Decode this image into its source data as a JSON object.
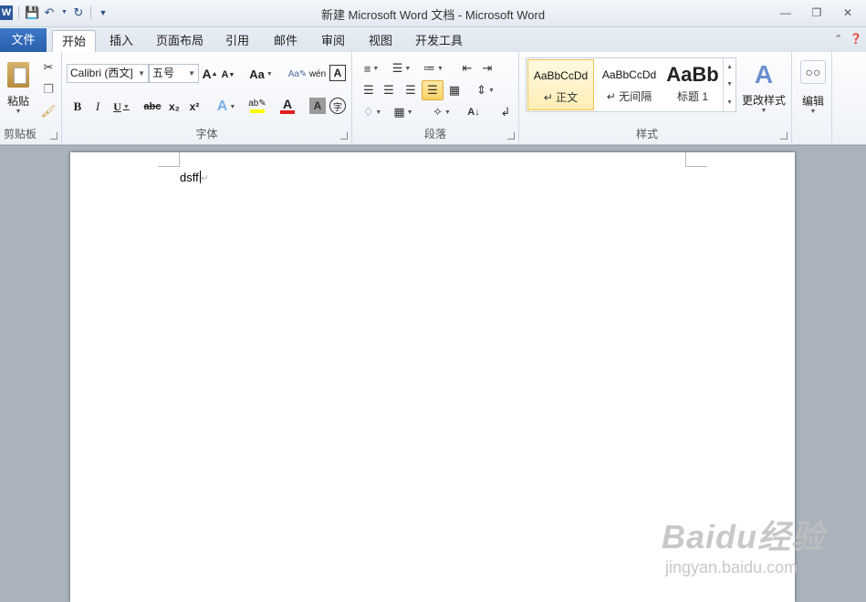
{
  "titlebar": {
    "title": "新建 Microsoft Word 文档 - Microsoft Word",
    "app_logo_letter": "W",
    "qat_icons": [
      "save-icon",
      "undo-icon",
      "redo-icon",
      "customize-qat-icon"
    ],
    "window_buttons": [
      "minimize",
      "restore",
      "close"
    ]
  },
  "tabs": {
    "file": "文件",
    "items": [
      "开始",
      "插入",
      "页面布局",
      "引用",
      "邮件",
      "审阅",
      "视图",
      "开发工具"
    ],
    "active": "开始"
  },
  "clipboard": {
    "paste_label": "粘贴",
    "group_label": "剪贴板"
  },
  "font": {
    "font_name": "Calibri (西文]",
    "font_size": "五号",
    "group_label": "字体",
    "change_case": "Aa",
    "bold": "B",
    "italic": "I",
    "underline": "U",
    "strike": "abc",
    "subscript": "x₂",
    "superscript": "x²",
    "font_color_letter": "A",
    "grow": "A",
    "shrink": "A"
  },
  "paragraph": {
    "group_label": "段落"
  },
  "styles": {
    "group_label": "样式",
    "items": [
      {
        "preview": "AaBbCcDd",
        "label": "↵ 正文"
      },
      {
        "preview": "AaBbCcDd",
        "label": "↵ 无间隔"
      },
      {
        "preview": "AaBb",
        "label": "标题 1"
      }
    ],
    "change_styles": "更改样式"
  },
  "editing": {
    "label": "编辑"
  },
  "document": {
    "text": "dsff"
  },
  "watermark": {
    "brand": "Baidu经验",
    "url": "jingyan.baidu.com"
  },
  "colors": {
    "file_tab": "#2a5fab",
    "highlight": "#ffff00",
    "font_color": "#e02020",
    "selected_style": "#f2c24d"
  }
}
